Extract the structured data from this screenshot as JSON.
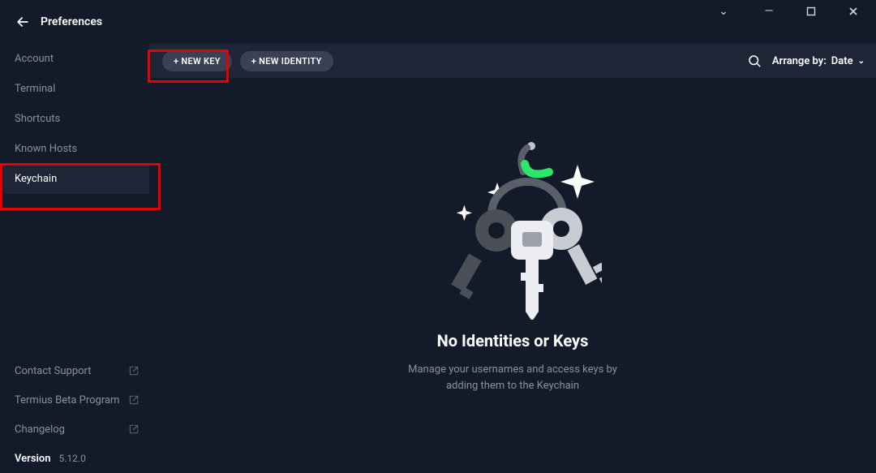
{
  "window": {
    "title": "Preferences"
  },
  "sidebar": {
    "nav": [
      {
        "label": "Account",
        "selected": false
      },
      {
        "label": "Terminal",
        "selected": false
      },
      {
        "label": "Shortcuts",
        "selected": false
      },
      {
        "label": "Known Hosts",
        "selected": false
      },
      {
        "label": "Keychain",
        "selected": true
      }
    ],
    "footer": [
      {
        "label": "Contact Support"
      },
      {
        "label": "Termius Beta Program"
      },
      {
        "label": "Changelog"
      }
    ],
    "version_label": "Version",
    "version_value": "5.12.0"
  },
  "toolbar": {
    "new_key": "+ NEW KEY",
    "new_identity": "+ NEW IDENTITY",
    "arrange_prefix": "Arrange by:",
    "arrange_value": "Date"
  },
  "empty_state": {
    "heading": "No Identities or Keys",
    "body": "Manage your usernames and access keys by adding them to the Keychain"
  }
}
